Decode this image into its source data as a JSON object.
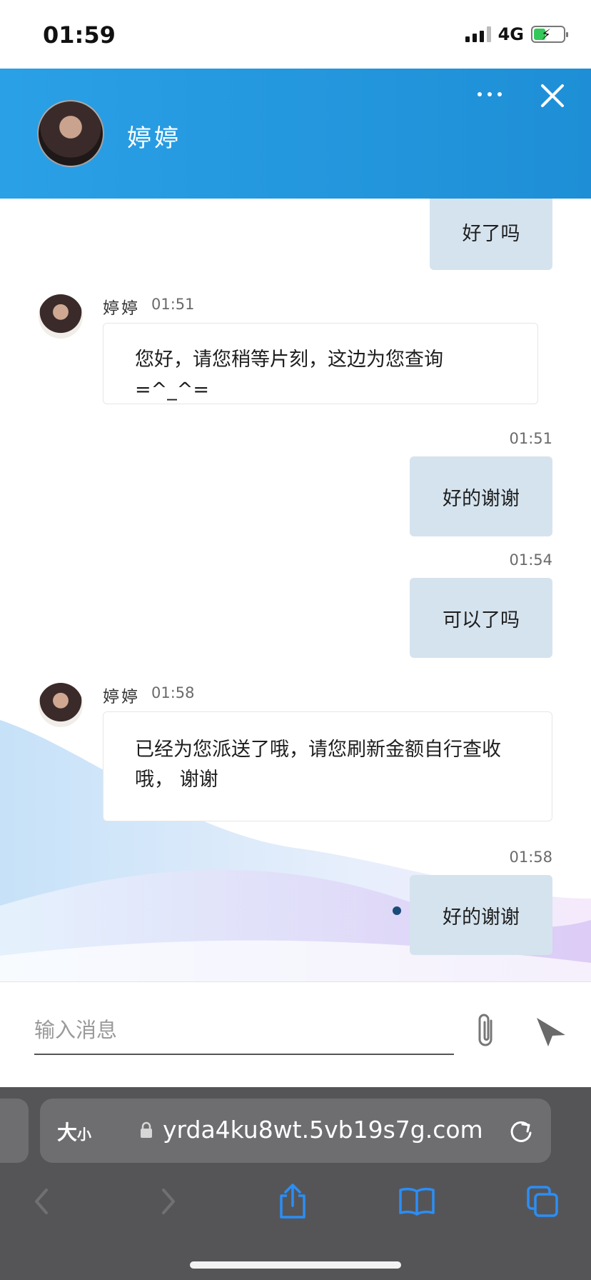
{
  "status_bar": {
    "time": "01:59",
    "network": "4G",
    "battery_level": 0.4
  },
  "header": {
    "agent_name": "婷婷",
    "more_icon": "more-horizontal-icon",
    "close_icon": "close-icon"
  },
  "messages": [
    {
      "side": "right",
      "time": "",
      "text": "好了吗"
    },
    {
      "side": "left",
      "sender": "婷婷",
      "time": "01:51",
      "text": "您好，请您稍等片刻，这边为您查询 =^_^="
    },
    {
      "side": "right",
      "time": "01:51",
      "text": "好的谢谢"
    },
    {
      "side": "right",
      "time": "01:54",
      "text": "可以了吗"
    },
    {
      "side": "left",
      "sender": "婷婷",
      "time": "01:58",
      "text": "已经为您派送了哦，请您刷新金额自行查收哦， 谢谢"
    },
    {
      "side": "right",
      "time": "01:58",
      "text": "好的谢谢"
    }
  ],
  "input": {
    "placeholder": "输入消息",
    "value": ""
  },
  "browser": {
    "text_size_large": "大",
    "text_size_small": "小",
    "url": "yrda4ku8wt.5vb19s7g.com"
  },
  "colors": {
    "header": "#1e8fd6",
    "bubble_right": "#d5e3ee",
    "browser_bg": "#555558",
    "nav_icon_active": "#2b8ef5"
  }
}
